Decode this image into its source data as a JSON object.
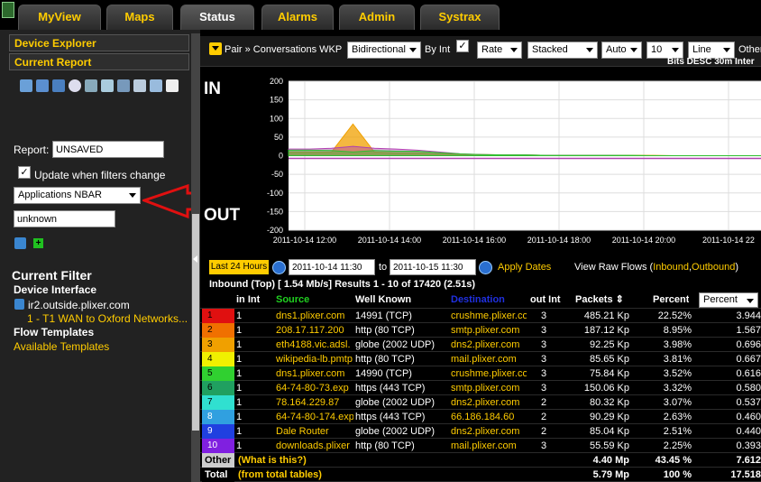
{
  "tabs": [
    {
      "label": "MyView"
    },
    {
      "label": "Maps"
    },
    {
      "label": "Status"
    },
    {
      "label": "Alarms"
    },
    {
      "label": "Admin"
    },
    {
      "label": "Systrax"
    }
  ],
  "left": {
    "device_explorer": "Device Explorer",
    "current_report": "Current Report",
    "report_label": "Report:",
    "report_value": "UNSAVED",
    "update_label": "Update when filters change",
    "app_select": "Applications NBAR",
    "filter_value": "unknown",
    "current_filter": "Current Filter",
    "device_interface": "Device Interface",
    "device_host": "ir2.outside.plixer.com",
    "device_if": "1 - T1 WAN to Oxford Networks...",
    "flow_templates": "Flow Templates",
    "available_templates": "Available Templates"
  },
  "topbar": {
    "breadcrumb": "Pair » Conversations WKP",
    "direction": "Bidirectional",
    "by_int": "By Int",
    "rate": "Rate",
    "stacked": "Stacked",
    "auto": "Auto",
    "count": "10",
    "line": "Line",
    "other": "Other",
    "sort_info": "Bits DESC 30m Inter"
  },
  "chart": {
    "in_label": "IN",
    "out_label": "OUT",
    "y_ticks": [
      "200",
      "150",
      "100",
      "50",
      "0",
      "-50",
      "-100",
      "-150",
      "-200"
    ],
    "x_ticks": [
      "2011-10-14 12:00",
      "2011-10-14 14:00",
      "2011-10-14 16:00",
      "2011-10-14 18:00",
      "2011-10-14 20:00",
      "2011-10-14 22"
    ]
  },
  "chart_data": {
    "type": "area",
    "title": "",
    "xlabel": "",
    "ylabel": "",
    "ylim": [
      -200,
      200
    ],
    "x": [
      "11:30",
      "12:00",
      "12:30",
      "13:00",
      "13:30",
      "14:00",
      "14:30",
      "15:00",
      "15:30",
      "16:00",
      "16:30",
      "17:00",
      "17:30",
      "18:00",
      "18:30",
      "19:00",
      "19:30",
      "20:00",
      "20:30",
      "21:00",
      "21:30",
      "22:00",
      "22:30"
    ],
    "series": [
      {
        "color": "#f0a000",
        "values": [
          10,
          10,
          10,
          85,
          10,
          8,
          8,
          5,
          4,
          3,
          2,
          2,
          1,
          1,
          1,
          1,
          1,
          1,
          0,
          0,
          0,
          0,
          0
        ]
      },
      {
        "color": "#b040b0",
        "values": [
          18,
          18,
          20,
          25,
          20,
          18,
          15,
          10,
          5,
          3,
          2,
          2,
          1,
          1,
          1,
          1,
          0,
          0,
          0,
          0,
          0,
          0,
          0
        ]
      },
      {
        "color": "#30c030",
        "values": [
          15,
          15,
          14,
          10,
          14,
          12,
          12,
          8,
          5,
          3,
          2,
          2,
          1,
          1,
          1,
          1,
          1,
          0,
          0,
          0,
          0,
          0,
          0
        ]
      }
    ]
  },
  "dates": {
    "range_btn": "Last 24 Hours",
    "start": "2011-10-14 11:30",
    "to": "to",
    "end": "2011-10-15 11:30",
    "apply": "Apply Dates",
    "raw": "View Raw Flows (",
    "inbound": "Inbound",
    "comma": ",",
    "outbound": "Outbound",
    "close": ")"
  },
  "results": "Inbound (Top) [ 1.54 Mb/s] Results 1 - 10 of 17420 (2.51s)",
  "table": {
    "headers": {
      "in_int": "in Int",
      "source": "Source",
      "well_known": "Well Known",
      "destination": "Destination",
      "out_int": "out Int",
      "packets": "Packets",
      "percent": "Percent",
      "pct_select": "Percent"
    },
    "rows": [
      {
        "n": "1",
        "color": "#e01010",
        "in": "1",
        "src": "dns1.plixer.com",
        "wk": "14991 (TCP)",
        "dst": "crushme.plixer.co",
        "out": "3",
        "pk": "485.21 Kp",
        "pct": "22.52%",
        "v": "3.944"
      },
      {
        "n": "2",
        "color": "#f07000",
        "in": "1",
        "src": "208.17.117.200",
        "wk": "http (80 TCP)",
        "dst": "smtp.plixer.com",
        "out": "3",
        "pk": "187.12 Kp",
        "pct": "8.95%",
        "v": "1.567"
      },
      {
        "n": "3",
        "color": "#f0a000",
        "in": "1",
        "src": "eth4188.vic.adsl.",
        "wk": "globe (2002 UDP)",
        "dst": "dns2.plixer.com",
        "out": "3",
        "pk": "92.25 Kp",
        "pct": "3.98%",
        "v": "0.696"
      },
      {
        "n": "4",
        "color": "#f0f000",
        "in": "1",
        "src": "wikipedia-lb.pmtp",
        "wk": "http (80 TCP)",
        "dst": "mail.plixer.com",
        "out": "3",
        "pk": "85.65 Kp",
        "pct": "3.81%",
        "v": "0.667"
      },
      {
        "n": "5",
        "color": "#30d030",
        "in": "1",
        "src": "dns1.plixer.com",
        "wk": "14990 (TCP)",
        "dst": "crushme.plixer.co",
        "out": "3",
        "pk": "75.84 Kp",
        "pct": "3.52%",
        "v": "0.616"
      },
      {
        "n": "6",
        "color": "#20a060",
        "in": "1",
        "src": "64-74-80-73.exp",
        "wk": "https (443 TCP)",
        "dst": "smtp.plixer.com",
        "out": "3",
        "pk": "150.06 Kp",
        "pct": "3.32%",
        "v": "0.580"
      },
      {
        "n": "7",
        "color": "#30e0d0",
        "in": "1",
        "src": "78.164.229.87",
        "wk": "globe (2002 UDP)",
        "dst": "dns2.plixer.com",
        "out": "2",
        "pk": "80.32 Kp",
        "pct": "3.07%",
        "v": "0.537"
      },
      {
        "n": "8",
        "color": "#30a0e0",
        "in": "1",
        "src": "64-74-80-174.exp",
        "wk": "https (443 TCP)",
        "dst": "66.186.184.60",
        "out": "2",
        "pk": "90.29 Kp",
        "pct": "2.63%",
        "v": "0.460"
      },
      {
        "n": "9",
        "color": "#2040e0",
        "in": "1",
        "src": "Dale Router",
        "wk": "globe (2002 UDP)",
        "dst": "dns2.plixer.com",
        "out": "2",
        "pk": "85.04 Kp",
        "pct": "2.51%",
        "v": "0.440"
      },
      {
        "n": "10",
        "color": "#8020e0",
        "in": "1",
        "src": "downloads.plixer",
        "wk": "http (80 TCP)",
        "dst": "mail.plixer.com",
        "out": "3",
        "pk": "55.59 Kp",
        "pct": "2.25%",
        "v": "0.393"
      }
    ],
    "other": {
      "label": "Other",
      "what": "(What is this?)",
      "pk": "4.40 Mp",
      "pct": "43.45 %",
      "v": "7.612"
    },
    "total": {
      "label": "Total",
      "what": "(from total tables)",
      "pk": "5.79 Mp",
      "pct": "100 %",
      "v": "17.518"
    }
  }
}
